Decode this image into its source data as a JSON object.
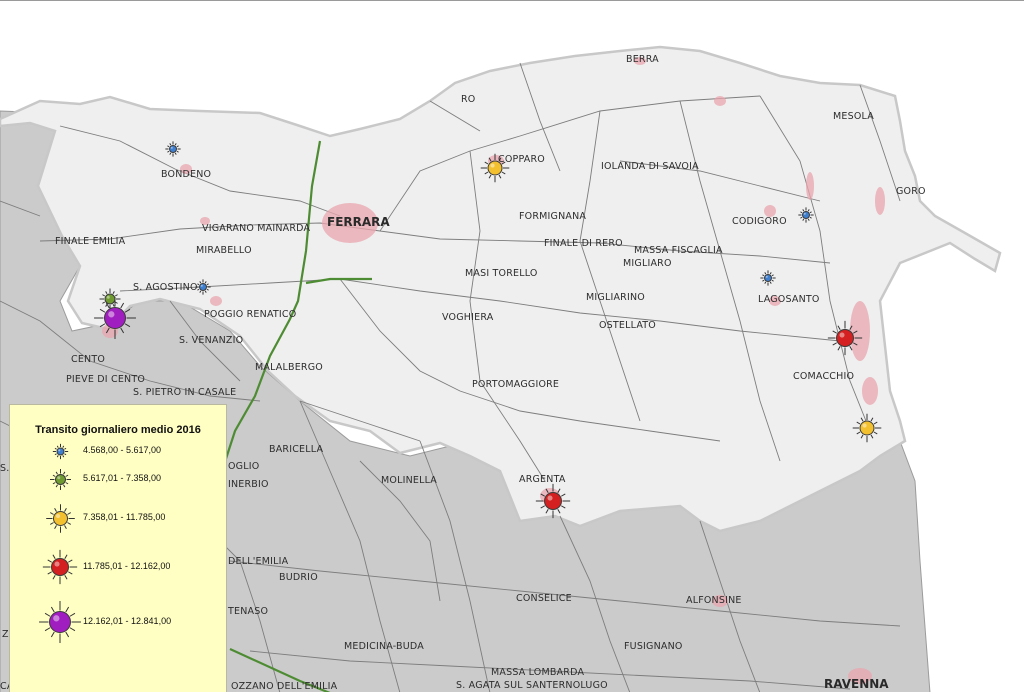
{
  "colors": {
    "province": "#efefef",
    "outside": "#cbcbcb",
    "road": "#7d7d7d",
    "urban": "#e8a5ad",
    "highway": "#4e8c33",
    "class_1": "#3f7fd0",
    "class_2": "#6f9a2f",
    "class_3": "#f3c12f",
    "class_4": "#d42020",
    "class_5": "#a01ec0"
  },
  "legend": {
    "title": "Transito giornaliero medio 2016",
    "classes": [
      {
        "range": "4.568,00 - 5.617,00",
        "color": "#3f7fd0",
        "size": 1,
        "icon": "blue-sun-marker-icon"
      },
      {
        "range": "5.617,01 - 7.358,00",
        "color": "#6f9a2f",
        "size": 2,
        "icon": "green-sun-marker-icon"
      },
      {
        "range": "7.358,01 - 11.785,00",
        "color": "#f3c12f",
        "size": 3,
        "icon": "yellow-sun-marker-icon"
      },
      {
        "range": "11.785,01 - 12.162,00",
        "color": "#d42020",
        "size": 4,
        "icon": "red-sun-marker-icon"
      },
      {
        "range": "12.162,01 - 12.841,00",
        "color": "#a01ec0",
        "size": 5,
        "icon": "purple-sun-marker-icon"
      }
    ]
  },
  "map": {
    "places": [
      {
        "name": "BERRA"
      },
      {
        "name": "RO"
      },
      {
        "name": "MESOLA"
      },
      {
        "name": "COPPARO"
      },
      {
        "name": "IOLANDA DI SAVOIA"
      },
      {
        "name": "GORO"
      },
      {
        "name": "BONDENO"
      },
      {
        "name": "FERRARA"
      },
      {
        "name": "VIGARANO MAINARDA"
      },
      {
        "name": "FORMIGNANA"
      },
      {
        "name": "CODIGORO"
      },
      {
        "name": "FINALE EMILIA"
      },
      {
        "name": "MIRABELLO"
      },
      {
        "name": "FINALE DI RERO"
      },
      {
        "name": "MASSA FISCAGLIA"
      },
      {
        "name": "MIGLIARO"
      },
      {
        "name": "MASI TORELLO"
      },
      {
        "name": "S. AGOSTINO"
      },
      {
        "name": "MIGLIARINO"
      },
      {
        "name": "LAGOSANTO"
      },
      {
        "name": "POGGIO RENATICO"
      },
      {
        "name": "VOGHIERA"
      },
      {
        "name": "OSTELLATO"
      },
      {
        "name": "S. VENANZIO"
      },
      {
        "name": "CENTO"
      },
      {
        "name": "MALALBERGO"
      },
      {
        "name": "COMACCHIO"
      },
      {
        "name": "PIEVE DI CENTO"
      },
      {
        "name": "S. PIETRO IN CASALE"
      },
      {
        "name": "PORTOMAGGIORE"
      },
      {
        "name": "BARICELLA"
      },
      {
        "name": "OGLIO"
      },
      {
        "name": "ARGENTA"
      },
      {
        "name": "MOLINELLA"
      },
      {
        "name": "INERBIO"
      },
      {
        "name": "DELL'EMILIA"
      },
      {
        "name": "BUDRIO"
      },
      {
        "name": "CONSELICE"
      },
      {
        "name": "ALFONSINE"
      },
      {
        "name": "TENASO"
      },
      {
        "name": "MEDICINA-BUDA"
      },
      {
        "name": "FUSIGNANO"
      },
      {
        "name": "MASSA LOMBARDA"
      },
      {
        "name": "RAVENNA"
      },
      {
        "name": "S. AGATA SUL SANTERNOLUGO"
      },
      {
        "name": "OZZANO DELL'EMILIA"
      },
      {
        "name": "CALDERINO"
      },
      {
        "name": "S."
      },
      {
        "name": "Z"
      }
    ],
    "stations": [
      {
        "class": 1,
        "near": "BONDENO"
      },
      {
        "class": 1,
        "near": "S. AGOSTINO"
      },
      {
        "class": 1,
        "near": "CODIGORO"
      },
      {
        "class": 1,
        "near": "LAGOSANTO"
      },
      {
        "class": 2,
        "near": "CENTO"
      },
      {
        "class": 3,
        "near": "COPPARO"
      },
      {
        "class": 3,
        "near": "COMACCHIO"
      },
      {
        "class": 4,
        "near": "COMACCHIO"
      },
      {
        "class": 4,
        "near": "ARGENTA"
      },
      {
        "class": 5,
        "near": "CENTO"
      }
    ]
  }
}
